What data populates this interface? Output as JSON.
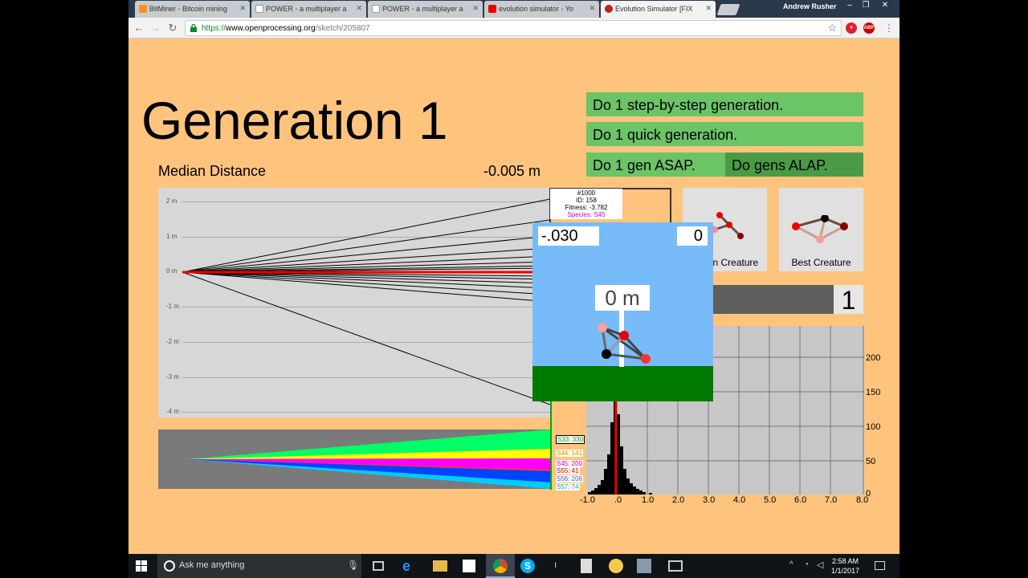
{
  "browser": {
    "tabs": [
      {
        "label": "BitMiner - Bitcoin mining",
        "icon": "bitcoin-icon"
      },
      {
        "label": "POWER - a multiplayer a",
        "icon": "page-icon"
      },
      {
        "label": "POWER - a multiplayer a",
        "icon": "page-icon"
      },
      {
        "label": "evolution simulator - Yo",
        "icon": "youtube-icon"
      },
      {
        "label": "Evolution Simulator [FIX",
        "icon": "openprocessing-icon"
      }
    ],
    "user": "Andrew Rusher",
    "url_scheme": "https://",
    "url_host": "www.openprocessing.org",
    "url_path": "/sketch/205807"
  },
  "sim": {
    "generation_title": "Generation 1",
    "median_label": "Median Distance",
    "median_value": "-0.005 m",
    "buttons": {
      "step": "Do 1 step-by-step generation.",
      "quick": "Do 1 quick generation.",
      "asap": "Do 1 gen ASAP.",
      "alap": "Do gens ALAP."
    },
    "y_ticks": [
      "2 m",
      "1 m",
      "0 m",
      "-1 m",
      "-2 m",
      "-3 m",
      "-4 m"
    ],
    "id_card": {
      "rank": "#1000",
      "id": "ID: 158",
      "fitness": "Fitness: -3.782",
      "species": "Species: S45"
    },
    "popup": {
      "timer": "-.030",
      "count": "0",
      "distance_marker": "0 m"
    },
    "median_creature_label": "an Creature",
    "best_creature_label": "Best Creature",
    "slider_value": "1",
    "species_labels": [
      {
        "text": "S33: 330",
        "color": "#00aa44"
      },
      {
        "text": "S44: 141",
        "color": "#b8a800"
      },
      {
        "text": "S45: 200",
        "color": "#d000d0"
      },
      {
        "text": "S55: 41",
        "color": "#cc0000"
      },
      {
        "text": "S56: 206",
        "color": "#3366ff"
      },
      {
        "text": "S57: 74",
        "color": "#00aacc"
      }
    ],
    "hist_x_labels": [
      "-1.0",
      ".0",
      "1.0",
      "2.0",
      "3.0",
      "4.0",
      "5.0",
      "6.0",
      "7.0",
      "8.0"
    ],
    "hist_y_labels": [
      "200",
      "150",
      "100",
      "50",
      "0"
    ]
  },
  "taskbar": {
    "search_placeholder": "Ask me anything",
    "time": "2:58 AM",
    "date": "1/1/2017"
  }
}
